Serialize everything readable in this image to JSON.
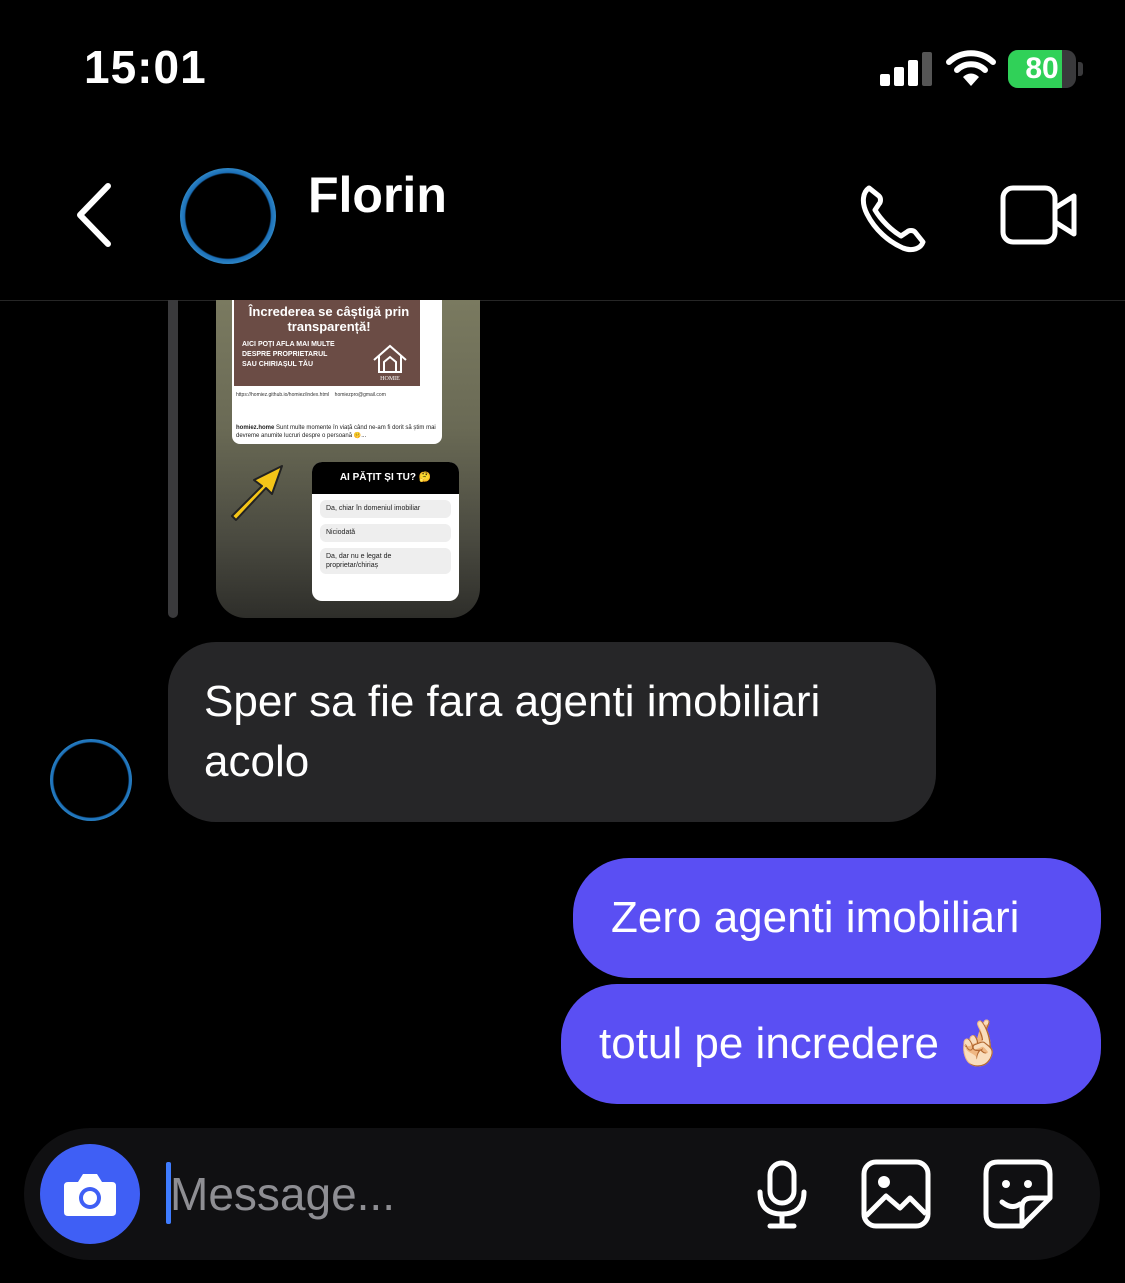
{
  "status_bar": {
    "time": "15:01",
    "battery_level": "80",
    "battery_fraction": 0.8,
    "battery_color": "#30d158"
  },
  "header": {
    "contact_name": "Florin",
    "icons": [
      "back-icon",
      "phone-icon",
      "video-icon"
    ]
  },
  "story_reply": {
    "post_headline": "Încrederea se câștigă prin transparență!",
    "post_subtext": "AICI POȚI AFLA MAI MULTE DESPRE PROPRIETARUL SAU CHIRIAȘUL TĂU",
    "post_logo_text": "HOMIE",
    "post_link": "https://homiez.github.io/homiez/index.html",
    "post_email": "homiezpro@gmail.com",
    "post_caption_user": "homiez.home",
    "post_caption": "Sunt multe momente în viață când ne-am fi dorit să știm mai devreme anumite lucruri despre o persoană 🤫...",
    "poll_question": "AI PĂȚIT ȘI TU? 🤔",
    "poll_options": [
      "Da, chiar în domeniul imobiliar",
      "Niciodată",
      "Da, dar nu e legat de proprietar/chiriaș"
    ]
  },
  "messages": [
    {
      "from": "Florin",
      "text": "Sper sa fie fara agenti imobiliari acolo"
    },
    {
      "from": "me",
      "text": "Zero agenti imobiliari"
    },
    {
      "from": "me",
      "text": "totul pe incredere 🤞🏻"
    }
  ],
  "composer": {
    "placeholder": "Message...",
    "icons": [
      "camera-icon",
      "microphone-icon",
      "gallery-icon",
      "sticker-icon"
    ]
  },
  "colors": {
    "outgoing_bubble": "#5a4ff3",
    "incoming_bubble": "#262628",
    "camera_button": "#3f5ff5"
  }
}
